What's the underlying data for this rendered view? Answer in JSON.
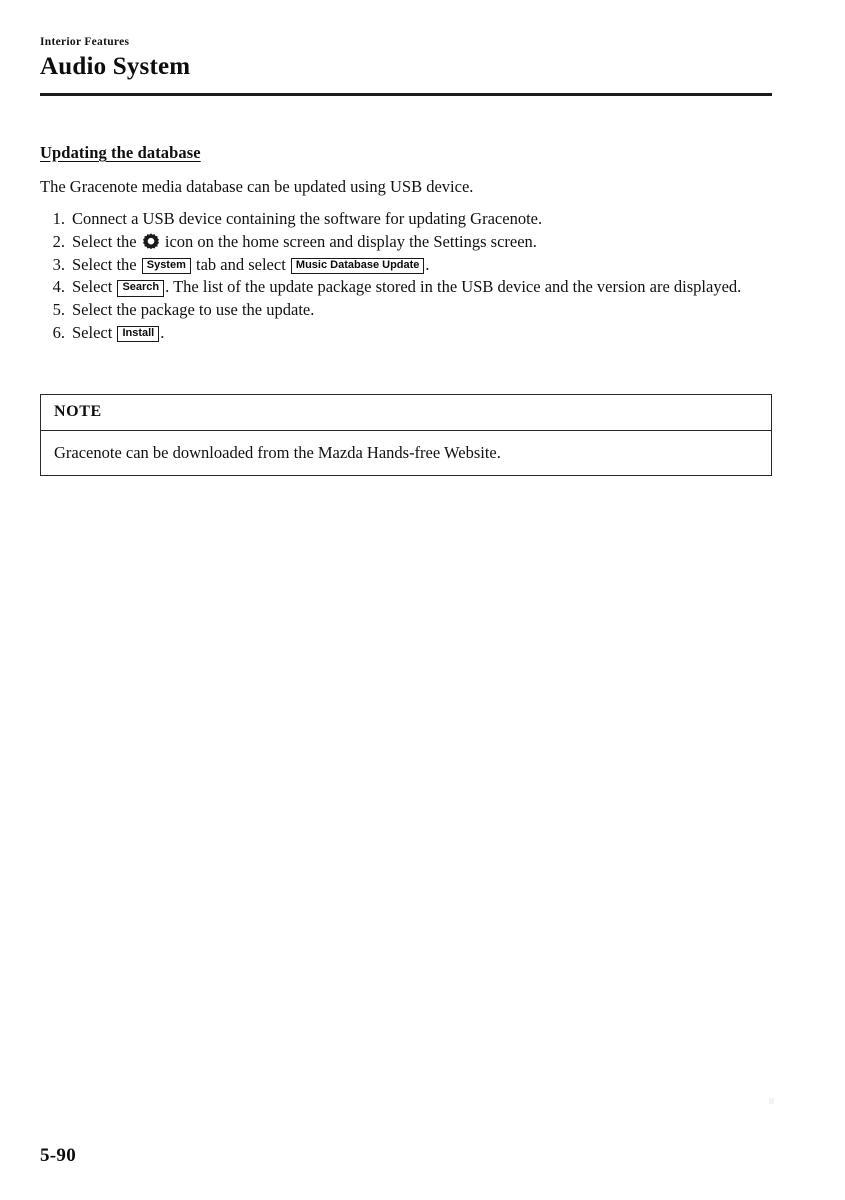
{
  "header": {
    "eyebrow": "Interior Features",
    "title": "Audio System"
  },
  "section": {
    "heading": "Updating the database",
    "intro": "The Gracenote media database can be updated using USB device."
  },
  "steps": [
    {
      "number": "1.",
      "parts": [
        {
          "type": "text",
          "value": "Connect a USB device containing the software for updating Gracenote."
        }
      ]
    },
    {
      "number": "2.",
      "parts": [
        {
          "type": "text",
          "value": "Select the "
        },
        {
          "type": "icon",
          "value": "gear-icon"
        },
        {
          "type": "text",
          "value": " icon on the home screen and display the Settings screen."
        }
      ]
    },
    {
      "number": "3.",
      "parts": [
        {
          "type": "text",
          "value": "Select the "
        },
        {
          "type": "key",
          "value": "System"
        },
        {
          "type": "text",
          "value": " tab and select "
        },
        {
          "type": "key",
          "value": "Music Database Update"
        },
        {
          "type": "text",
          "value": "."
        }
      ]
    },
    {
      "number": "4.",
      "parts": [
        {
          "type": "text",
          "value": "Select "
        },
        {
          "type": "key",
          "value": "Search"
        },
        {
          "type": "text",
          "value": ". The list of the update package stored in the USB device and the version are displayed."
        }
      ]
    },
    {
      "number": "5.",
      "parts": [
        {
          "type": "text",
          "value": "Select the package to use the update."
        }
      ]
    },
    {
      "number": "6.",
      "parts": [
        {
          "type": "text",
          "value": "Select "
        },
        {
          "type": "key",
          "value": "Install"
        },
        {
          "type": "text",
          "value": "."
        }
      ]
    }
  ],
  "note": {
    "label": "NOTE",
    "body": "Gracenote can be downloaded from the Mazda Hands-free Website."
  },
  "footer": {
    "page_number": "5-90"
  },
  "colors": {
    "text": "#121212",
    "rule": "#1b1b1b",
    "box_border": "#2a2a2a",
    "page_background": "#ffffff"
  }
}
